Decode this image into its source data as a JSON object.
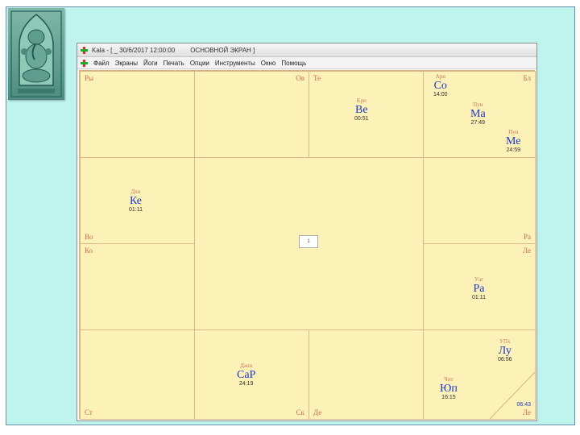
{
  "window": {
    "title": "Kala - [ _ 30/6/2017 12:00:00",
    "title_screen": "ОСНОВНОЙ ЭКРАН ]"
  },
  "menu": [
    "Файл",
    "Экраны",
    "Йоги",
    "Печать",
    "Опции",
    "Инструменты",
    "Окно",
    "Помощь"
  ],
  "signs": {
    "ry": "Ры",
    "ov": "Ов",
    "te": "Те",
    "bl": "Бл",
    "vo": "Во",
    "ra": "Ра",
    "ko": "Ко",
    "le": "Ле",
    "st": "Ст",
    "sk": "Ск",
    "de": "Де",
    "le2": "Ле"
  },
  "planets": {
    "su": {
      "nak": "Ари",
      "name": "Со",
      "deg": "14:00"
    },
    "ve": {
      "nak": "Кри",
      "name": "Ве",
      "deg": "00:51"
    },
    "ma": {
      "nak": "Пун",
      "name": "Ма",
      "deg": "27:49"
    },
    "me": {
      "nak": "Пун",
      "name": "Ме",
      "deg": "24:59"
    },
    "ke": {
      "nak": "Дхн",
      "name": "Ке",
      "deg": "01:11"
    },
    "ra": {
      "nak": "Уаг",
      "name": "Ра",
      "deg": "01:11"
    },
    "mo": {
      "nak": "УПх",
      "name": "Лу",
      "deg": "06:56"
    },
    "sa": {
      "nak": "Джш",
      "name": "СаР",
      "deg": "24:19"
    },
    "ju": {
      "nak": "Чит",
      "name": "Юп",
      "deg": "16:15"
    }
  },
  "asc_degree": "06:43",
  "center_label": "1"
}
